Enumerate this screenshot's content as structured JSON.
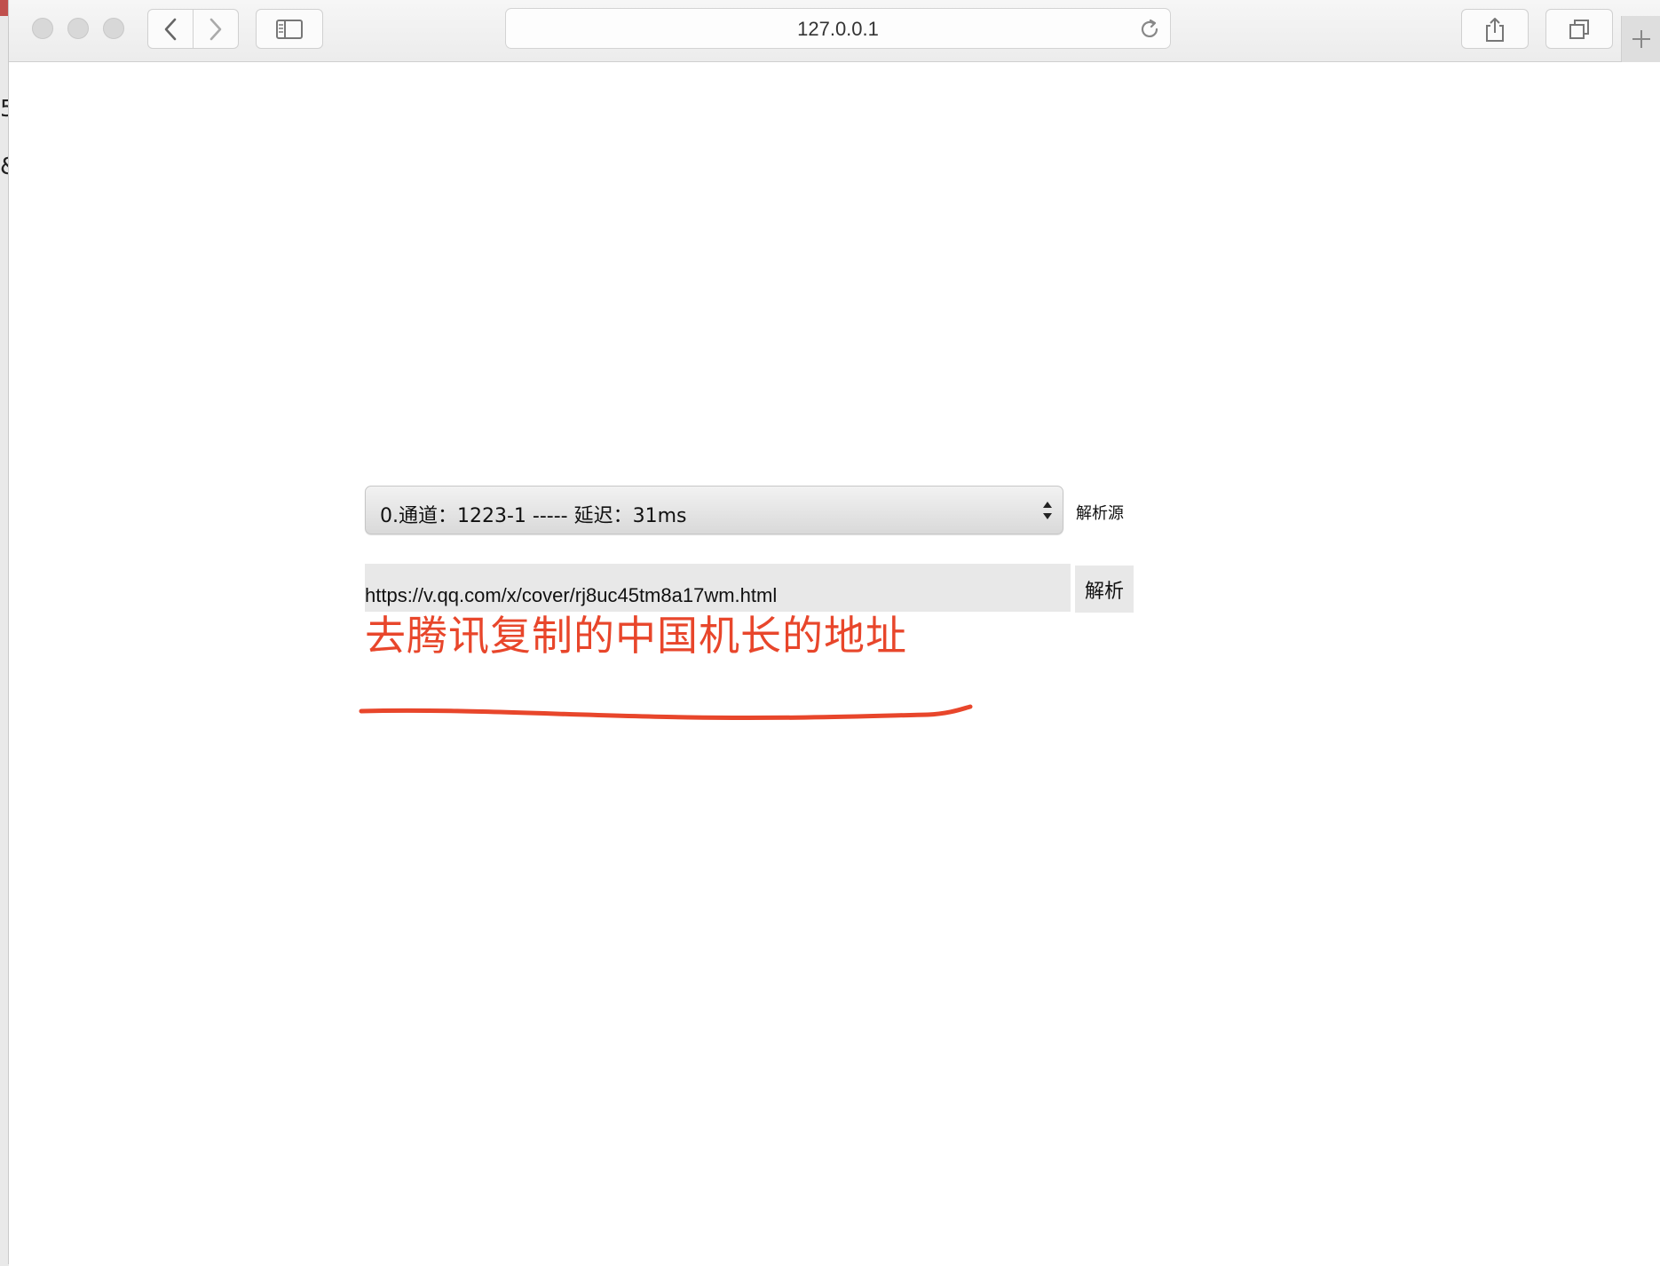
{
  "background_window": {
    "fragments": [
      "5",
      "&"
    ]
  },
  "browser": {
    "url": "127.0.0.1",
    "traffic_lights": [
      "close",
      "minimize",
      "zoom"
    ],
    "icons": {
      "back": "chevron-left-icon",
      "forward": "chevron-right-icon",
      "sidebar": "sidebar-icon",
      "reload": "reload-icon",
      "share": "share-icon",
      "tabs": "tabs-overview-icon",
      "new_tab": "plus-icon"
    }
  },
  "page": {
    "source_select": {
      "selected": "0.通道：1223-1 ----- 延迟：31ms",
      "label": "解析源"
    },
    "url_input": {
      "value": "https://v.qq.com/x/cover/rj8uc45tm8a17wm.html"
    },
    "parse_button": {
      "label": "解析"
    },
    "annotation": {
      "text": "去腾讯复制的中国机长的地址",
      "color": "#e8462b"
    }
  }
}
